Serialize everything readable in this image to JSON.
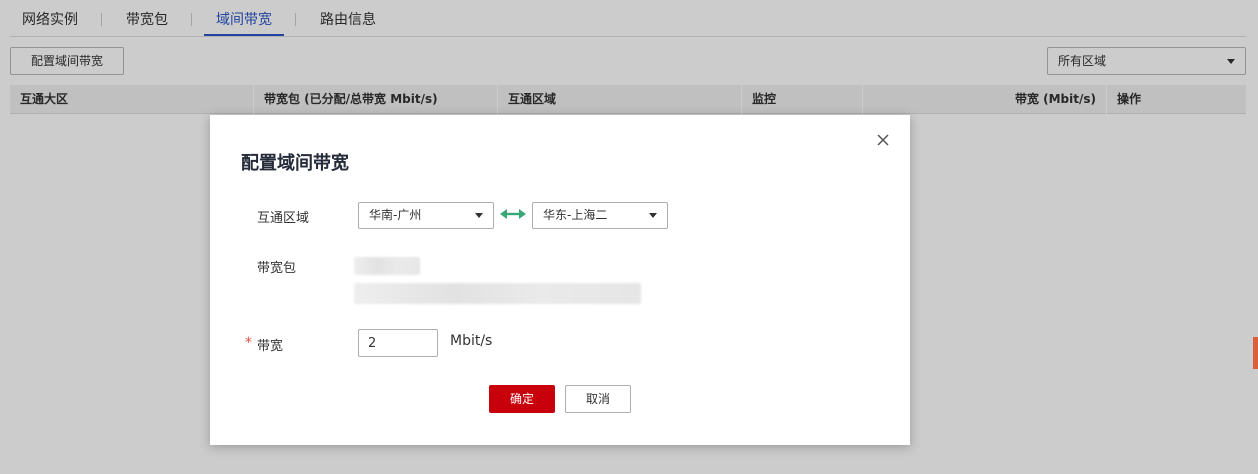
{
  "tabs": [
    {
      "label": "网络实例",
      "active": false
    },
    {
      "label": "带宽包",
      "active": false
    },
    {
      "label": "域间带宽",
      "active": true
    },
    {
      "label": "路由信息",
      "active": false
    }
  ],
  "toolbar": {
    "config_button": "配置域间带宽",
    "region_filter": "所有区域"
  },
  "table": {
    "columns": [
      "互通大区",
      "带宽包 (已分配/总带宽 Mbit/s)",
      "互通区域",
      "监控",
      "带宽 (Mbit/s)",
      "操作"
    ]
  },
  "modal": {
    "title": "配置域间带宽",
    "labels": {
      "region": "互通区域",
      "package": "带宽包",
      "bandwidth": "带宽"
    },
    "required_mark": "*",
    "region_from": "华南-广州",
    "region_to": "华东-上海二",
    "bandwidth_value": "2",
    "bandwidth_unit": "Mbit/s",
    "ok_label": "确定",
    "cancel_label": "取消"
  },
  "colors": {
    "accent": "#2b55c7",
    "primary_button": "#c7000b",
    "swap_icon": "#3aa776",
    "required": "#e04c3a"
  },
  "icons": {
    "close": "close-icon",
    "swap": "bidirectional-arrow-icon",
    "dropdown": "chevron-down-icon"
  }
}
